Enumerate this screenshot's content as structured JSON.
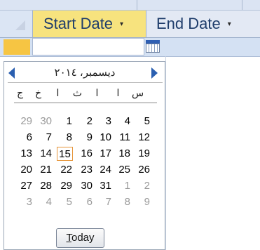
{
  "columns": {
    "start": {
      "label": "Start Date",
      "dropdown": "▾"
    },
    "end": {
      "label": "End Date",
      "dropdown": "▾"
    }
  },
  "calendar": {
    "month_label": "ديسمبر، ٢٠١٤",
    "weekdays": [
      "ج",
      "خ",
      "ا",
      "ث",
      "ا",
      "ا",
      "س"
    ],
    "weeks": [
      [
        {
          "d": "29",
          "other": true
        },
        {
          "d": "30",
          "other": true
        },
        {
          "d": "1"
        },
        {
          "d": "2"
        },
        {
          "d": "3"
        },
        {
          "d": "4"
        },
        {
          "d": "5"
        }
      ],
      [
        {
          "d": "6"
        },
        {
          "d": "7"
        },
        {
          "d": "8"
        },
        {
          "d": "9"
        },
        {
          "d": "10"
        },
        {
          "d": "11"
        },
        {
          "d": "12"
        }
      ],
      [
        {
          "d": "13"
        },
        {
          "d": "14"
        },
        {
          "d": "15",
          "today": true
        },
        {
          "d": "16"
        },
        {
          "d": "17"
        },
        {
          "d": "18"
        },
        {
          "d": "19"
        }
      ],
      [
        {
          "d": "20"
        },
        {
          "d": "21"
        },
        {
          "d": "22"
        },
        {
          "d": "23"
        },
        {
          "d": "24"
        },
        {
          "d": "25"
        },
        {
          "d": "26"
        }
      ],
      [
        {
          "d": "27"
        },
        {
          "d": "28"
        },
        {
          "d": "29"
        },
        {
          "d": "30"
        },
        {
          "d": "31"
        },
        {
          "d": "1",
          "other": true
        },
        {
          "d": "2",
          "other": true
        }
      ],
      [
        {
          "d": "3",
          "other": true
        },
        {
          "d": "4",
          "other": true
        },
        {
          "d": "5",
          "other": true
        },
        {
          "d": "6",
          "other": true
        },
        {
          "d": "7",
          "other": true
        },
        {
          "d": "8",
          "other": true
        },
        {
          "d": "9",
          "other": true
        }
      ]
    ],
    "today_button": {
      "accel": "T",
      "rest": "oday"
    }
  },
  "colors": {
    "accent": "#2a5fb0",
    "today_border": "#e6953a",
    "header_active": "#f7e37e"
  }
}
